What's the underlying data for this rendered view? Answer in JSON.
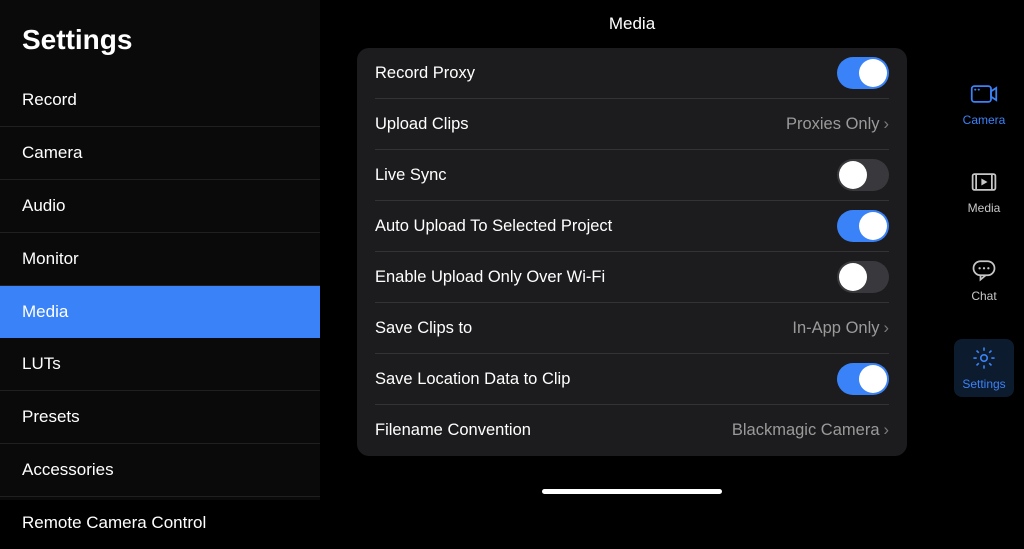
{
  "settingsTitle": "Settings",
  "sidebar": {
    "items": [
      {
        "label": "Record"
      },
      {
        "label": "Camera"
      },
      {
        "label": "Audio"
      },
      {
        "label": "Monitor"
      },
      {
        "label": "Media",
        "active": true
      },
      {
        "label": "LUTs"
      },
      {
        "label": "Presets"
      },
      {
        "label": "Accessories"
      },
      {
        "label": "Remote Camera Control"
      }
    ]
  },
  "main": {
    "title": "Media",
    "rows": [
      {
        "label": "Record Proxy",
        "type": "toggle",
        "value": true
      },
      {
        "label": "Upload Clips",
        "type": "nav",
        "value": "Proxies Only"
      },
      {
        "label": "Live Sync",
        "type": "toggle",
        "value": false
      },
      {
        "label": "Auto Upload To Selected Project",
        "type": "toggle",
        "value": true
      },
      {
        "label": "Enable Upload Only Over Wi-Fi",
        "type": "toggle",
        "value": false
      },
      {
        "label": "Save Clips to",
        "type": "nav",
        "value": "In-App Only"
      },
      {
        "label": "Save Location Data to Clip",
        "type": "toggle",
        "value": true
      },
      {
        "label": "Filename Convention",
        "type": "nav",
        "value": "Blackmagic Camera"
      }
    ]
  },
  "rightnav": {
    "items": [
      {
        "label": "Camera"
      },
      {
        "label": "Media"
      },
      {
        "label": "Chat"
      },
      {
        "label": "Settings",
        "active": true
      }
    ]
  }
}
